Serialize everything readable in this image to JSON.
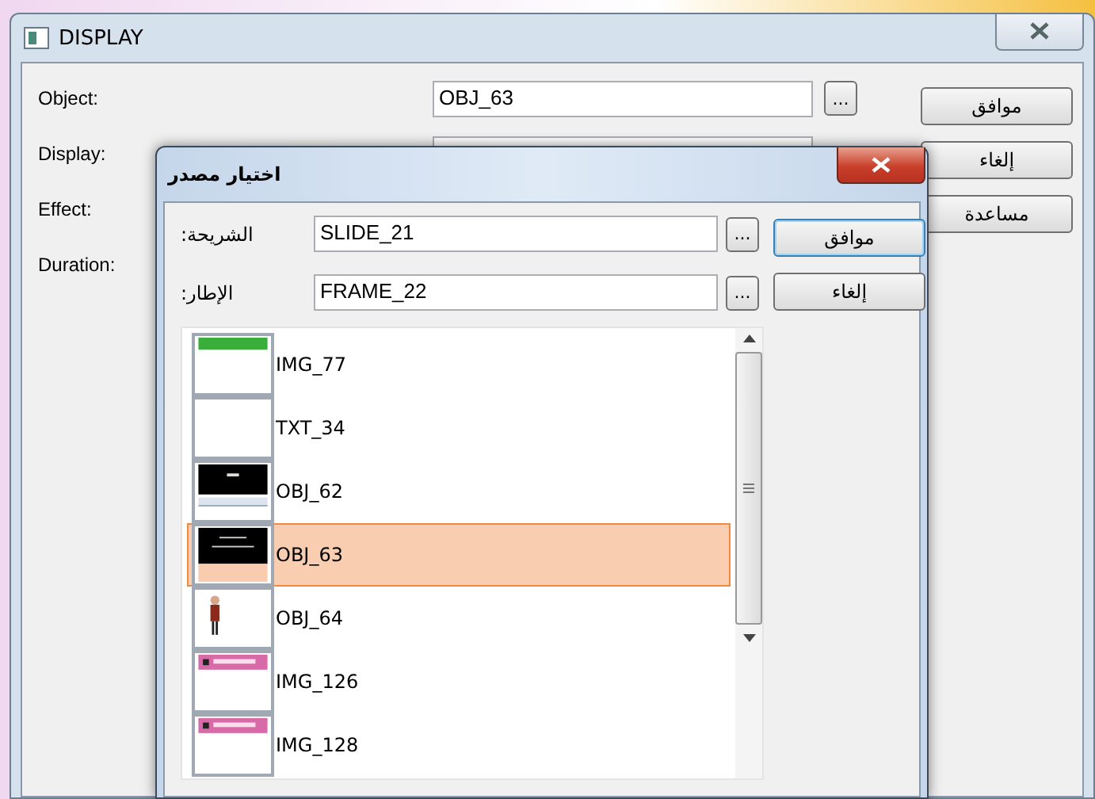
{
  "window": {
    "title": "DISPLAY",
    "fields": [
      {
        "label": "Object:",
        "value": "OBJ_63"
      },
      {
        "label": "Display:"
      },
      {
        "label": "Effect:"
      },
      {
        "label": "Duration:"
      }
    ],
    "browse_button": "...",
    "buttons": [
      {
        "label": "موافق"
      },
      {
        "label": "إلغاء"
      },
      {
        "label": "مساعدة"
      }
    ]
  },
  "dialog": {
    "title": "اختيار مصدر",
    "fields": [
      {
        "label": "الشريحة:",
        "value": "SLIDE_21",
        "browse": "..."
      },
      {
        "label": "الإطار:",
        "value": "FRAME_22",
        "browse": "..."
      }
    ],
    "buttons": [
      {
        "label": "موافق",
        "focused": true
      },
      {
        "label": "إلغاء",
        "focused": false
      }
    ],
    "items": [
      {
        "name": "IMG_77",
        "kind": "greenbar",
        "selected": false
      },
      {
        "name": "TXT_34",
        "kind": "blank",
        "selected": false
      },
      {
        "name": "OBJ_62",
        "kind": "banner",
        "selected": false
      },
      {
        "name": "OBJ_63",
        "kind": "darktext",
        "selected": true
      },
      {
        "name": "OBJ_64",
        "kind": "figure",
        "selected": false
      },
      {
        "name": "IMG_126",
        "kind": "pinkbar",
        "selected": false
      },
      {
        "name": "IMG_128",
        "kind": "pinkbar",
        "selected": false
      }
    ]
  }
}
